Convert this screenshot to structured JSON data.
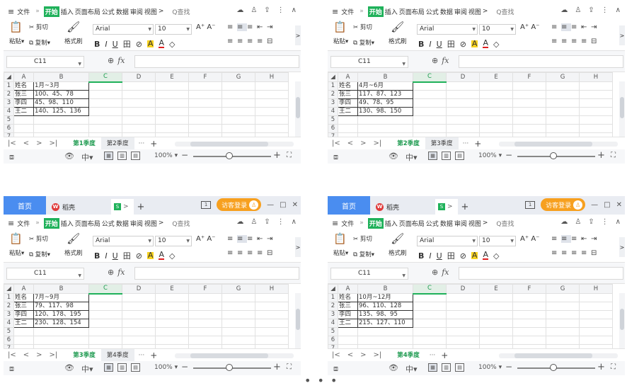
{
  "titlebar": {
    "home_tab": "首页",
    "draft_tab": "稻壳",
    "wps_logo": "W",
    "sheet_logo": "S",
    "chevron": ">",
    "plus": "+",
    "mono_btn": "1",
    "visitor_login": "访客登录",
    "minimize": "—",
    "maximize": "□",
    "close": "✕"
  },
  "menu": {
    "hamburger": "≡",
    "file": "文件",
    "more": "»",
    "start": "开始",
    "insert": "插入",
    "page_layout": "页面布局",
    "formula": "公式",
    "data": "数据",
    "review": "审阅",
    "view": "视图",
    "tab_more": ">",
    "search": "Q查找",
    "cloud_icon": "☁",
    "user_icon": "♙",
    "share_icon": "⇪",
    "kebab": "⋮",
    "collapse": "∧"
  },
  "ribbon": {
    "paste": "粘贴",
    "cut": "剪切",
    "copy": "复制",
    "format_painter": "格式刷",
    "font_name": "Arial",
    "font_size": "10",
    "grow_font": "A⁺",
    "shrink_font": "A⁻",
    "bold": "B",
    "italic": "I",
    "underline": "U",
    "border": "田",
    "fill": "A",
    "font_color": "A",
    "clear": "◇",
    "expand": ">",
    "align_icons": [
      "≡",
      "≡",
      "≡",
      "⇤",
      "⇥",
      "≡",
      "≡",
      "≡",
      "≡",
      "⊟"
    ]
  },
  "formula_bar": {
    "cell_ref": "C11",
    "zoom_icon": "⊕",
    "fx": "fx"
  },
  "grid": {
    "columns": [
      "A",
      "B",
      "C",
      "D",
      "E",
      "F",
      "G",
      "H"
    ],
    "rows": [
      "1",
      "2",
      "3",
      "4",
      "5",
      "6",
      "7"
    ],
    "header_a1": "姓名",
    "names": [
      "张三",
      "李四",
      "王二"
    ]
  },
  "panes": [
    {
      "period": "1月~3月",
      "values": [
        "100、45、78",
        "45、98、110",
        "140、125、136"
      ],
      "tabs": [
        "第1季度",
        "第2季度"
      ],
      "show_titlebar": false
    },
    {
      "period": "4月~6月",
      "values": [
        "117、87、123",
        "49、78、95",
        "130、98、150"
      ],
      "tabs": [
        "第2季度",
        "第3季度"
      ],
      "show_titlebar": false
    },
    {
      "period": "7月~9月",
      "values": [
        "79、117、98",
        "120、178、195",
        "230、128、154"
      ],
      "tabs": [
        "第3季度",
        "第4季度"
      ],
      "show_titlebar": true
    },
    {
      "period": "10月~12月",
      "values": [
        "96、110、128",
        "135、98、95",
        "215、127、110"
      ],
      "tabs": [
        "第4季度"
      ],
      "show_titlebar": true
    }
  ],
  "sheetbar": {
    "first": "|<",
    "prev": "<",
    "next": ">",
    "last": ">|",
    "more": "···",
    "add": "+"
  },
  "status": {
    "zoom": "100%",
    "minus": "−",
    "plus": "+",
    "full": "⛶"
  },
  "ellipsis": "• • •"
}
